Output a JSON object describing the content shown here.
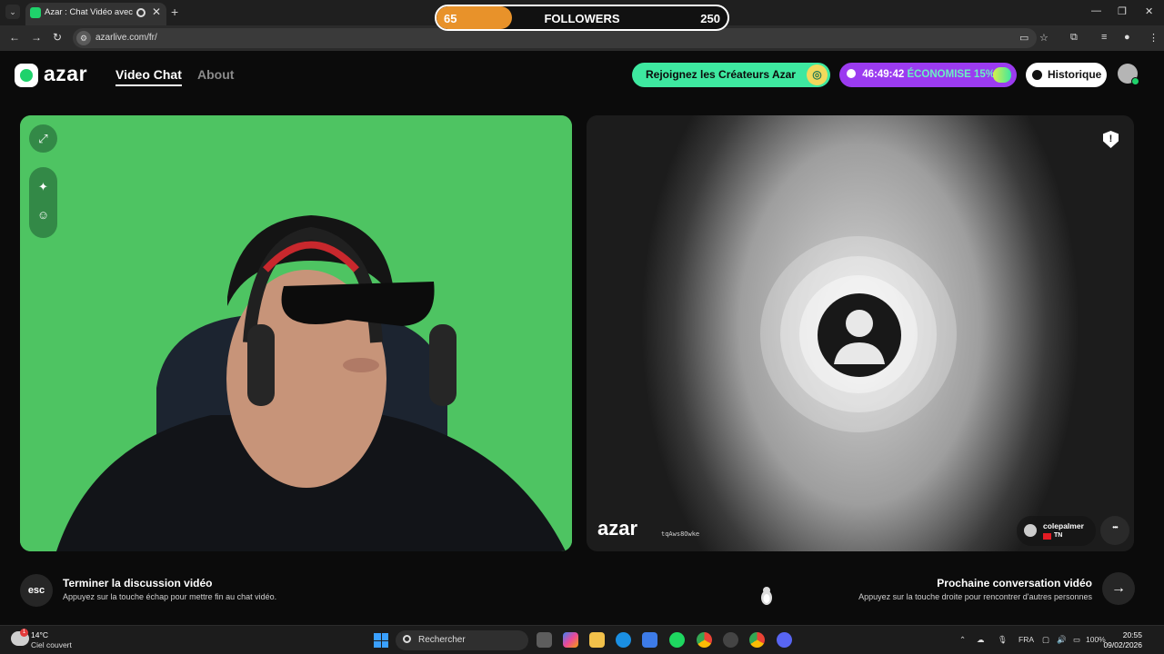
{
  "browser": {
    "tab_title": "Azar : Chat Vidéo avec de n",
    "tab_close": "✕",
    "new_tab": "+",
    "url": "azarlive.com/fr/",
    "minimize": "—",
    "maximize": "❐",
    "close": "✕"
  },
  "followers_overlay": {
    "current": "65",
    "label": "FOLLOWERS",
    "goal": "250",
    "progress": 0.26,
    "fill_color": "#e8922a"
  },
  "header": {
    "logo": "azar",
    "nav_video_chat": "Video Chat",
    "nav_about": "About",
    "creators_button": "Rejoignez les Créateurs Azar",
    "promo_timer": "46:49:42",
    "promo_save": "ÉCONOMISE 15%",
    "history_button": "Historique",
    "accent_color": "#1fd26b",
    "promo_color": "#9b3bf0"
  },
  "remote": {
    "watermark_logo": "azar",
    "watermark_id": "tqAws8Owke",
    "peer_name": "colepalmer",
    "peer_country": "TN",
    "report_symbol": "!"
  },
  "footer": {
    "esc_key": "esc",
    "end_title": "Terminer la discussion vidéo",
    "end_sub": "Appuyez sur la touche échap pour mettre fin au chat vidéo.",
    "next_title": "Prochaine conversation vidéo",
    "next_sub": "Appuyez sur la touche droite pour rencontrer d'autres personnes",
    "next_arrow": "→"
  },
  "taskbar": {
    "weather_temp": "14°C",
    "weather_desc": "Ciel couvert",
    "weather_badge": "1",
    "search_placeholder": "Rechercher",
    "language": "FRA",
    "battery": "100%",
    "time": "20:55",
    "date": "09/02/2026"
  }
}
